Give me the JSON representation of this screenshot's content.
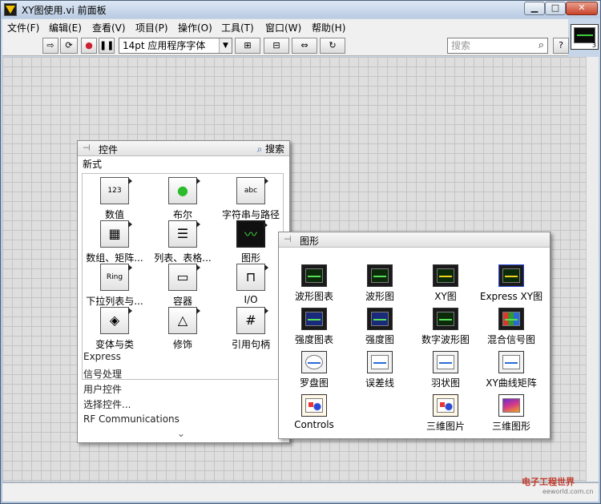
{
  "window": {
    "title": "XY图使用.vi 前面板",
    "buttons": {
      "minimize": "▁",
      "maximize": "□",
      "close": "✕"
    }
  },
  "menubar": {
    "items": [
      "文件(F)",
      "编辑(E)",
      "查看(V)",
      "项目(P)",
      "操作(O)",
      "工具(T)",
      "窗口(W)",
      "帮助(H)"
    ]
  },
  "toolbar": {
    "run_arrow": "⇨",
    "run_continuous": "⟳",
    "abort": "●",
    "pause": "❚❚",
    "font": "14pt 应用程序字体",
    "align": "⊞",
    "distribute": "⊟",
    "resize": "⇔",
    "reorder": "↻",
    "search_placeholder": "搜索",
    "help": "?"
  },
  "connector_pane": {
    "count": "3"
  },
  "controls_palette": {
    "title": "控件",
    "search": "搜索",
    "section": "新式",
    "items": [
      {
        "label": "数值",
        "icon": "numeric-icon"
      },
      {
        "label": "布尔",
        "icon": "boolean-icon"
      },
      {
        "label": "字符串与路径",
        "icon": "string-path-icon"
      },
      {
        "label": "数组、矩阵...",
        "icon": "array-matrix-icon"
      },
      {
        "label": "列表、表格...",
        "icon": "list-table-icon"
      },
      {
        "label": "图形",
        "icon": "graph-icon"
      },
      {
        "label": "下拉列表与...",
        "icon": "ring-enum-icon"
      },
      {
        "label": "容器",
        "icon": "container-icon"
      },
      {
        "label": "I/O",
        "icon": "io-icon"
      },
      {
        "label": "变体与类",
        "icon": "variant-class-icon"
      },
      {
        "label": "修饰",
        "icon": "decorations-icon"
      },
      {
        "label": "引用句柄",
        "icon": "refnum-icon"
      }
    ],
    "glyphs": {
      "numeric": "123",
      "boolean": "●",
      "string": "abc",
      "array": "▦",
      "list": "☰",
      "graph": "〰",
      "ring": "Ring",
      "container": "▭",
      "io": "⊓",
      "variant": "◈",
      "decor": "△",
      "refnum": "#"
    },
    "categories": [
      "Express",
      "信号处理",
      "用户控件",
      "选择控件...",
      "RF Communications"
    ],
    "more": "⌄"
  },
  "graph_palette": {
    "title": "图形",
    "items": [
      {
        "label": "波形图表",
        "icon": "waveform-chart-icon"
      },
      {
        "label": "波形图",
        "icon": "waveform-graph-icon"
      },
      {
        "label": "XY图",
        "icon": "xy-graph-icon"
      },
      {
        "label": "Express XY图",
        "icon": "express-xy-graph-icon"
      },
      {
        "label": "强度图表",
        "icon": "intensity-chart-icon"
      },
      {
        "label": "强度图",
        "icon": "intensity-graph-icon"
      },
      {
        "label": "数字波形图",
        "icon": "digital-waveform-icon"
      },
      {
        "label": "混合信号图",
        "icon": "mixed-signal-icon"
      },
      {
        "label": "罗盘图",
        "icon": "compass-plot-icon"
      },
      {
        "label": "误差线",
        "icon": "error-bar-icon"
      },
      {
        "label": "羽状图",
        "icon": "feather-plot-icon"
      },
      {
        "label": "XY曲线矩阵",
        "icon": "xy-matrix-icon"
      },
      {
        "label": "Controls",
        "icon": "controls-icon"
      },
      {
        "label": "三维图片",
        "icon": "3d-picture-icon"
      },
      {
        "label": "三维图形",
        "icon": "3d-graph-icon"
      }
    ]
  },
  "watermark": {
    "text": "电子工程世界",
    "sub": "eeworld.com.cn"
  }
}
